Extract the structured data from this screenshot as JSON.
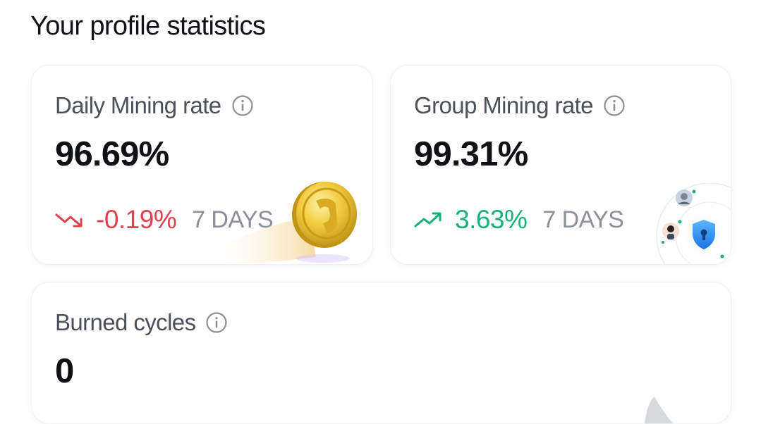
{
  "page": {
    "title": "Your profile statistics"
  },
  "cards": {
    "daily": {
      "label": "Daily Mining rate",
      "value": "96.69%",
      "trend_value": "-0.19%",
      "trend_direction": "down",
      "trend_period": "7 DAYS",
      "trend_color": "#e0404f",
      "icons": [
        "info-icon",
        "trend-down-icon",
        "gold-coin-illustration"
      ]
    },
    "group": {
      "label": "Group Mining rate",
      "value": "99.31%",
      "trend_value": "3.63%",
      "trend_direction": "up",
      "trend_period": "7 DAYS",
      "trend_color": "#16b07a",
      "icons": [
        "info-icon",
        "trend-up-icon",
        "network-shield-illustration"
      ]
    },
    "burned": {
      "label": "Burned cycles",
      "value": "0",
      "icons": [
        "info-icon",
        "shark-fin-illustration"
      ]
    }
  }
}
